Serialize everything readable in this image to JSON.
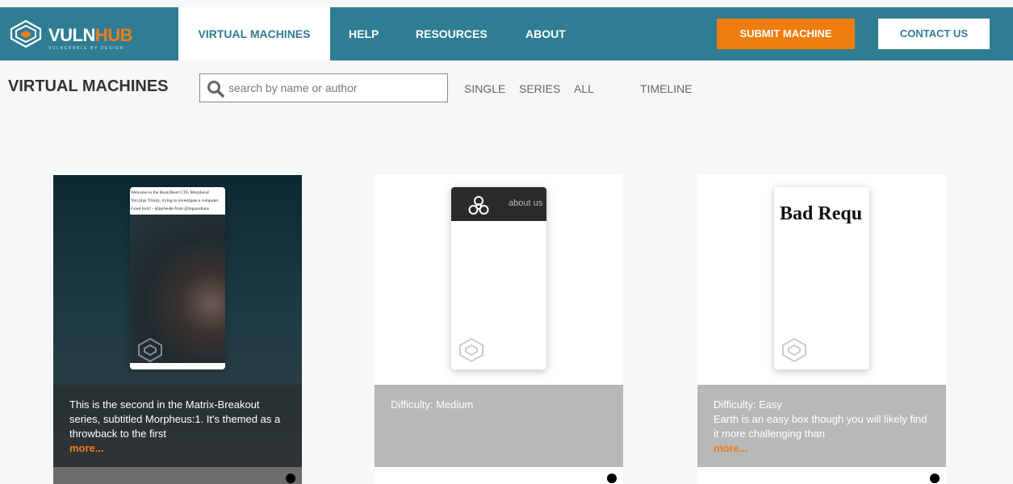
{
  "header": {
    "logo_main": "VULN",
    "logo_accent": "HUB",
    "logo_tagline": "VULNERABLE BY DESIGN",
    "nav": [
      "VIRTUAL MACHINES",
      "HELP",
      "RESOURCES",
      "ABOUT"
    ],
    "submit_label": "SUBMIT MACHINE",
    "contact_label": "CONTACT US"
  },
  "subheader": {
    "title": "VIRTUAL MACHINES",
    "search_placeholder": "search by name or author",
    "filters": [
      "SINGLE",
      "SERIES",
      "ALL",
      "TIMELINE"
    ]
  },
  "cards": [
    {
      "screenshot_lines": [
        "Welcome to the Boot2Root CTF, Morpheus!",
        "You play Trinity, trying to investigate a computer",
        "Good luck! - @jaybeale from @inguardians"
      ],
      "description": "This is the second in the Matrix-Breakout series, subtitled Morpheus:1. It's themed as a throwback to the first",
      "more": "more..."
    },
    {
      "screenshot_text": "about us",
      "description": "Difficulty: Medium"
    },
    {
      "screenshot_text": "Bad Requ",
      "description": "Difficulty: Easy\nEarth is an easy box though you will likely find it more challenging than",
      "more": "more..."
    }
  ],
  "colors": {
    "brand_teal": "#2f7d92",
    "accent_orange": "#f07d0f"
  }
}
